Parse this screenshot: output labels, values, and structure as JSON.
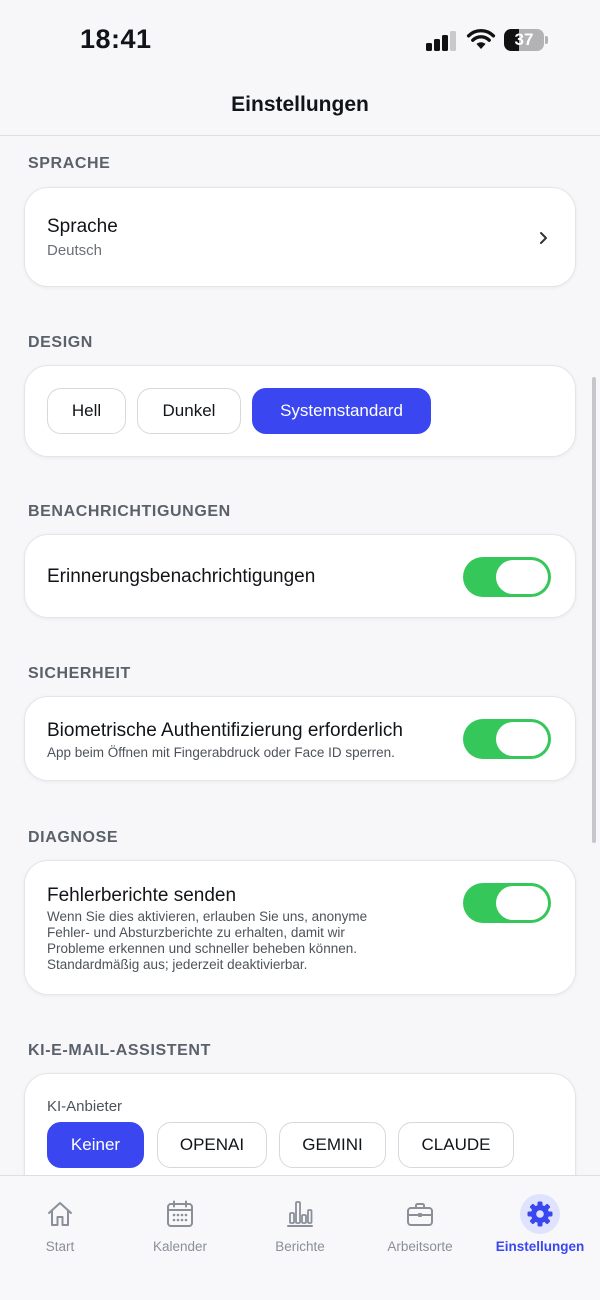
{
  "status_bar": {
    "time": "18:41",
    "battery": "37",
    "battery_level": 0.37
  },
  "header": {
    "title": "Einstellungen"
  },
  "sections": {
    "language": {
      "title": "SPRACHE",
      "row_title": "Sprache",
      "row_value": "Deutsch"
    },
    "design": {
      "title": "DESIGN",
      "options": [
        "Hell",
        "Dunkel",
        "Systemstandard"
      ],
      "selected": "Systemstandard"
    },
    "notifications": {
      "title": "BENACHRICHTIGUNGEN",
      "row_title": "Erinnerungsbenachrichtigungen",
      "enabled": true
    },
    "security": {
      "title": "SICHERHEIT",
      "row_title": "Biometrische Authentifizierung erforderlich",
      "row_desc": "App beim Öffnen mit Fingerabdruck oder Face ID sperren.",
      "enabled": true
    },
    "diagnostics": {
      "title": "DIAGNOSE",
      "row_title": "Fehlerberichte senden",
      "desc_lines": [
        "Wenn Sie dies aktivieren, erlauben Sie uns, anonyme",
        "Fehler- und Absturzberichte zu erhalten, damit wir",
        "Probleme erkennen und schneller beheben können.",
        "Standardmäßig aus; jederzeit deaktivierbar."
      ],
      "enabled": true
    },
    "ai_assistant": {
      "title": "KI-E-MAIL-ASSISTENT",
      "provider_label": "KI-Anbieter",
      "providers": [
        "Keiner",
        "OPENAI",
        "GEMINI",
        "CLAUDE"
      ],
      "selected": "Keiner"
    }
  },
  "tabbar": {
    "items": [
      {
        "label": "Start",
        "icon": "home-icon"
      },
      {
        "label": "Kalender",
        "icon": "calendar-icon"
      },
      {
        "label": "Berichte",
        "icon": "bar-chart-icon"
      },
      {
        "label": "Arbeitsorte",
        "icon": "briefcase-icon"
      },
      {
        "label": "Einstellungen",
        "icon": "gear-icon"
      }
    ],
    "active": "Einstellungen"
  },
  "colors": {
    "accent": "#3a46f0",
    "toggle_on": "#35c759",
    "background": "#f7f7f9"
  }
}
